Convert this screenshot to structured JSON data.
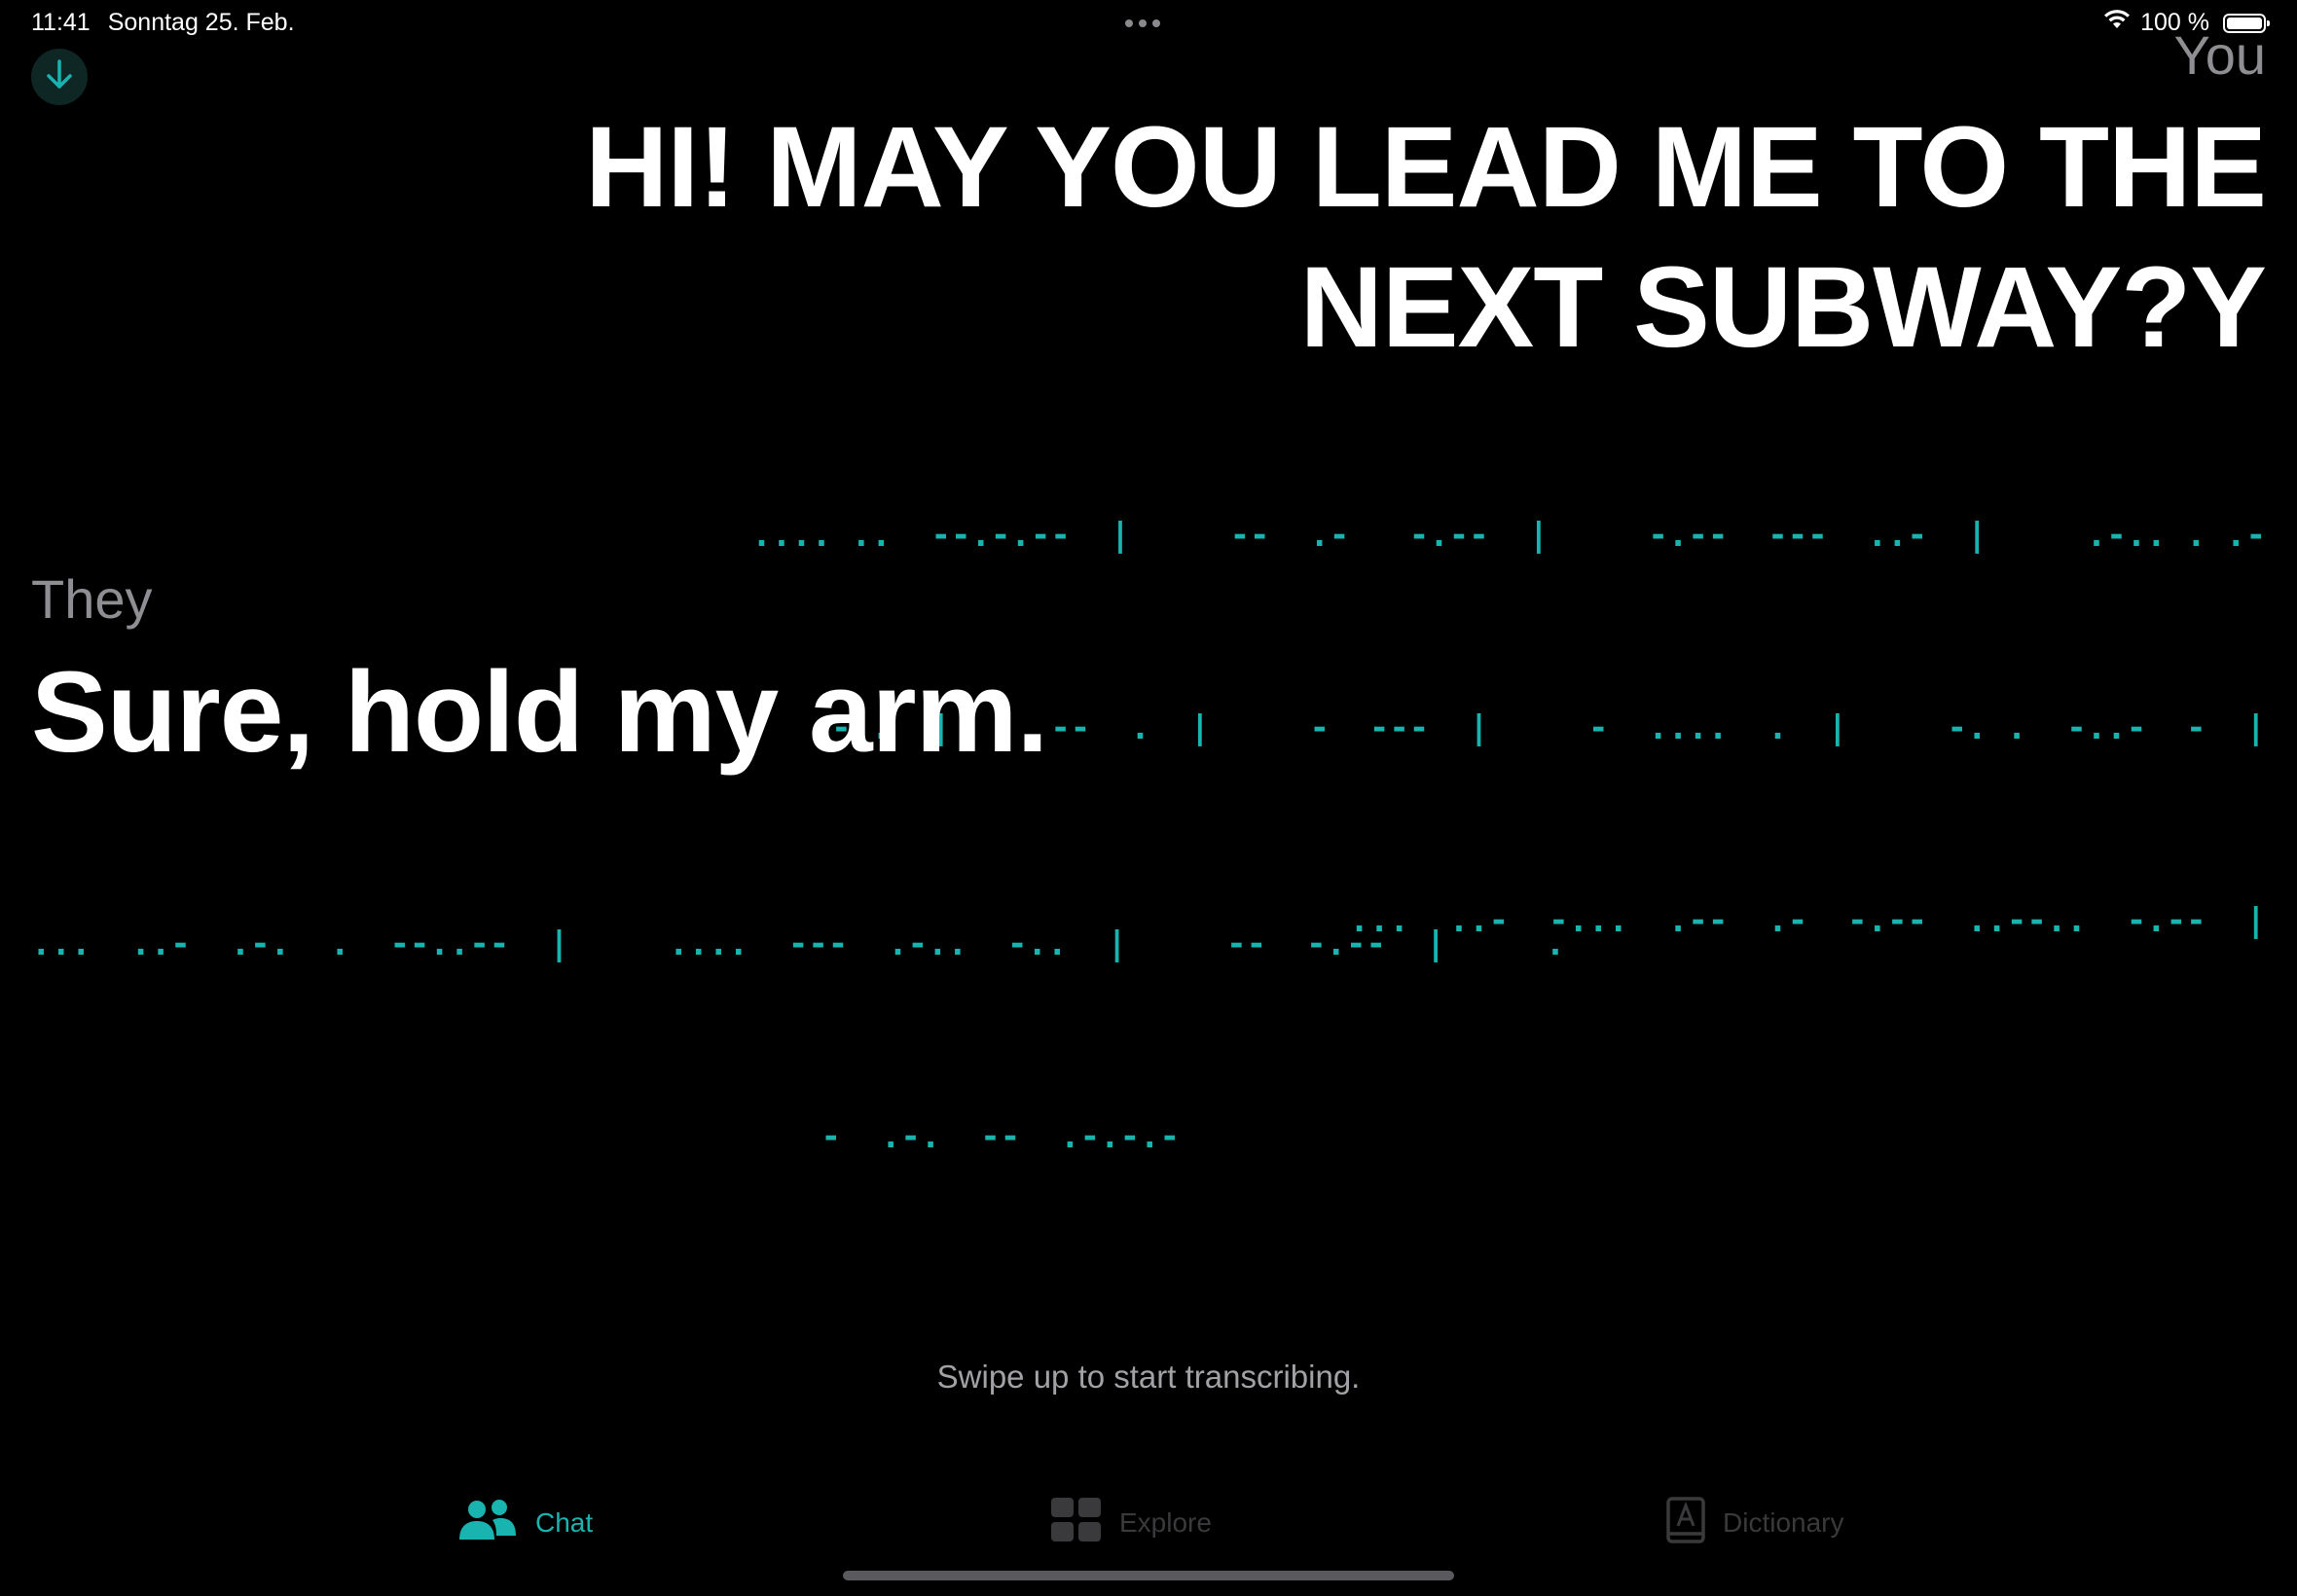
{
  "status_bar": {
    "time": "11:41",
    "date": "Sonntag 25. Feb.",
    "battery": "100 %",
    "icons": [
      "wifi-icon",
      "battery-icon",
      "more-dots-icon"
    ]
  },
  "scroll_button": {
    "icon": "arrow-down-icon"
  },
  "you": {
    "label": "You",
    "message": "HI! MAY YOU LEAD ME TO THE NEXT SUBWAY?Y",
    "morse_lines": [
      ".... ..  --.-.--  |     --  .-   -.--  |     -.--  ---  ..-  |     .-.. . .-",
      "-..  |     --  .  |     -  ---  |     -  ....  .  |     -. .  -..-  -  |",
      "...  ..-  -...  .--  .-  -.--  ..--..  -.--  |"
    ]
  },
  "they": {
    "label": "They",
    "message": "Sure, hold my arm.",
    "morse_lines": [
      "...  ..-  .-.  .  --..--  |     ....  ---  .-..  -..  |     --  -.--  |     .",
      "-  .-.  --  .-.-.-"
    ]
  },
  "hint": "Swipe up to start transcribing.",
  "tabs": [
    {
      "label": "Chat",
      "icon": "people-icon",
      "active": true
    },
    {
      "label": "Explore",
      "icon": "grid-icon",
      "active": false
    },
    {
      "label": "Dictionary",
      "icon": "book-icon",
      "active": false
    }
  ],
  "colors": {
    "accent": "#19b3b0",
    "background": "#000000",
    "secondary_text": "#8e8e93",
    "inactive_tab": "#3a3a3c"
  }
}
